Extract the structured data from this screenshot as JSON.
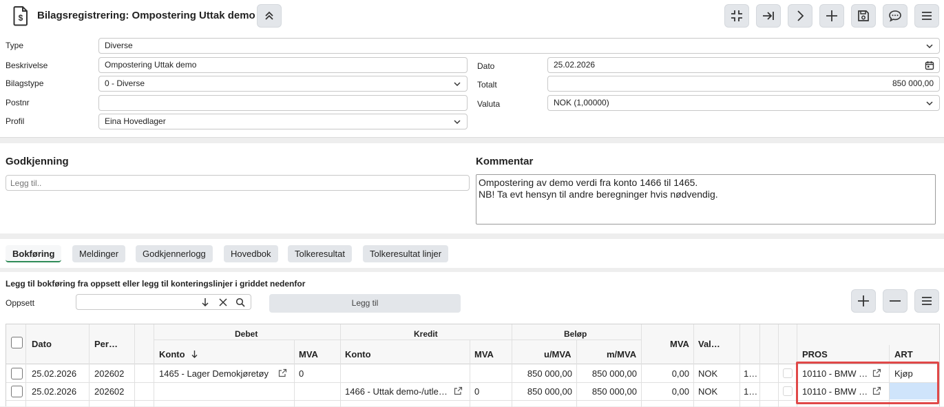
{
  "header": {
    "title": "Bilagsregistrering: Ompostering Uttak demo"
  },
  "form": {
    "type_label": "Type",
    "type_value": "Diverse",
    "beskrivelse_label": "Beskrivelse",
    "beskrivelse_value": "Ompostering Uttak demo",
    "bilagstype_label": "Bilagstype",
    "bilagstype_value": "0 - Diverse",
    "postnr_label": "Postnr",
    "postnr_value": "",
    "profil_label": "Profil",
    "profil_value": "Eina Hovedlager",
    "dato_label": "Dato",
    "dato_value": "25.02.2026",
    "totalt_label": "Totalt",
    "totalt_value": "850 000,00",
    "valuta_label": "Valuta",
    "valuta_value": "NOK (1,00000)"
  },
  "approval": {
    "heading": "Godkjenning",
    "placeholder": "Legg til..",
    "comment_heading": "Kommentar",
    "comment_text": "Ompostering av demo verdi fra konto 1466 til 1465.\nNB!  Ta evt hensyn til andre beregninger hvis nødvendig."
  },
  "tabs": [
    "Bokføring",
    "Meldinger",
    "Godkjennerlogg",
    "Hovedbok",
    "Tolkeresultat",
    "Tolkeresultat linjer"
  ],
  "posting": {
    "instruction": "Legg til bokføring fra oppsett eller legg til konteringslinjer i griddet nedenfor",
    "oppsett_label": "Oppsett",
    "oppsett_value": "",
    "add_button": "Legg til"
  },
  "grid": {
    "headers": {
      "dato": "Dato",
      "per": "Per…",
      "debet": "Debet",
      "kredit": "Kredit",
      "belop": "Beløp",
      "mva": "MVA",
      "val": "Val…",
      "debet_konto": "Konto",
      "debet_mva": "MVA",
      "kredit_konto": "Konto",
      "kredit_mva": "MVA",
      "u_mva": "u/MVA",
      "m_mva": "m/MVA",
      "pros": "PROS",
      "art": "ART"
    },
    "rows": [
      {
        "dato": "25.02.2026",
        "per": "202602",
        "debet_konto": "1465 - Lager Demokjøretøy",
        "debet_mva": "0",
        "kredit_konto": "",
        "kredit_mva": "",
        "u_mva": "850 000,00",
        "m_mva": "850 000,00",
        "mva": "0,00",
        "val": "NOK",
        "extra": "1…",
        "pros": "10110 - BMW …",
        "art": "Kjøp"
      },
      {
        "dato": "25.02.2026",
        "per": "202602",
        "debet_konto": "",
        "debet_mva": "",
        "kredit_konto": "1466 - Uttak demo-/utle…",
        "kredit_mva": "0",
        "u_mva": "850 000,00",
        "m_mva": "850 000,00",
        "mva": "0,00",
        "val": "NOK",
        "extra": "1…",
        "pros": "10110 - BMW …",
        "art": ""
      }
    ]
  },
  "colors": {
    "accent_green": "#2e8b57",
    "highlight_red": "#e04848",
    "selected_cell": "#cfe4fb"
  }
}
